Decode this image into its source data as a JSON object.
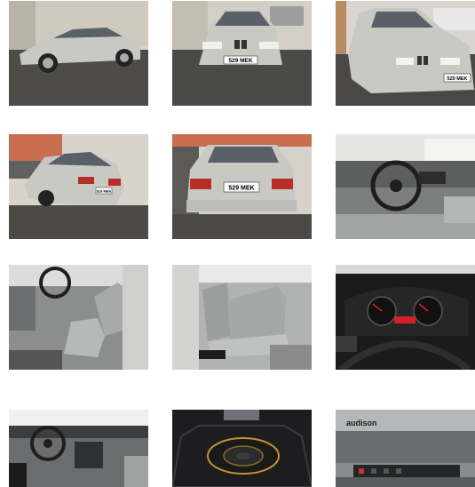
{
  "gallery": {
    "photos": [
      {
        "id": "photo-1",
        "subject": "car-exterior-side"
      },
      {
        "id": "photo-2",
        "subject": "car-front",
        "plate": "529 MEK"
      },
      {
        "id": "photo-3",
        "subject": "car-front-angle",
        "plate": "529 MEK"
      },
      {
        "id": "photo-4",
        "subject": "car-rear-angle",
        "plate": "529 MEK"
      },
      {
        "id": "photo-5",
        "subject": "car-rear",
        "plate": "529 MEK"
      },
      {
        "id": "photo-6",
        "subject": "dashboard-steering"
      },
      {
        "id": "photo-7",
        "subject": "front-seats"
      },
      {
        "id": "photo-8",
        "subject": "rear-seats"
      },
      {
        "id": "photo-9",
        "subject": "instrument-cluster"
      },
      {
        "id": "photo-10",
        "subject": "dashboard-wide"
      },
      {
        "id": "photo-11",
        "subject": "trunk-subwoofer"
      },
      {
        "id": "photo-12",
        "subject": "amplifier",
        "brand": "audison"
      }
    ]
  },
  "colors": {
    "car_silver": "#c9c9c4",
    "asphalt": "#4a4a48",
    "wall": "#d8d4cc",
    "interior_grey": "#8f9090",
    "cluster_red": "#d2202a"
  }
}
